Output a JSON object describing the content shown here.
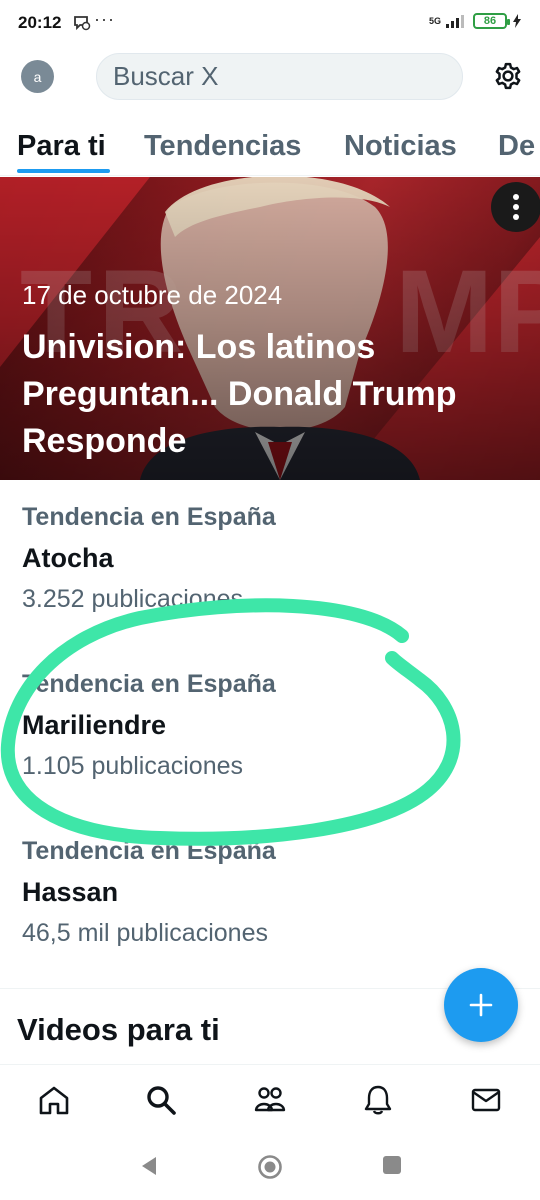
{
  "status_bar": {
    "time": "20:12",
    "more": "···",
    "network": "5G",
    "battery": "86"
  },
  "header": {
    "avatar_letter": "a",
    "search_placeholder": "Buscar X"
  },
  "tabs": [
    {
      "label": "Para ti",
      "active": true
    },
    {
      "label": "Tendencias",
      "active": false
    },
    {
      "label": "Noticias",
      "active": false
    },
    {
      "label": "De",
      "active": false
    }
  ],
  "hero": {
    "date": "17 de octubre de 2024",
    "title": "Univision: Los latinos Preguntan... Donald Trump Responde",
    "image_text": "TRUMP"
  },
  "trends": [
    {
      "context": "Tendencia en España",
      "name": "Atocha",
      "count": "3.252 publicaciones"
    },
    {
      "context": "Tendencia en España",
      "name": "Mariliendre",
      "count": "1.105 publicaciones"
    },
    {
      "context": "Tendencia en España",
      "name": "Hassan",
      "count": "46,5 mil publicaciones"
    }
  ],
  "videos_section": {
    "title": "Videos para ti"
  },
  "bottom_nav": [
    "home-icon",
    "search-icon",
    "communities-icon",
    "notifications-icon",
    "messages-icon"
  ],
  "colors": {
    "accent": "#1d9bf0",
    "annotation": "#3ee6a8",
    "text_primary": "#0f1419",
    "text_secondary": "#536471"
  }
}
